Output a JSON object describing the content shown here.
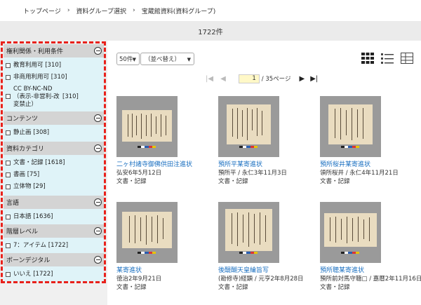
{
  "breadcrumb": {
    "items": [
      "トップページ",
      "資料グループ選択",
      "宝蔵館資料(資料グループ)"
    ]
  },
  "result_count": "1722件",
  "facets": [
    {
      "title": "権利関係・利用条件",
      "items": [
        {
          "label": "教育利用可",
          "count": "[310]"
        },
        {
          "label": "非商用利用可",
          "count": "[310]"
        },
        {
          "label": "CC BY-NC-ND（表示-非営利-改変禁止）",
          "count": "[310]"
        }
      ]
    },
    {
      "title": "コンテンツ",
      "items": [
        {
          "label": "静止画",
          "count": "[308]"
        }
      ]
    },
    {
      "title": "資料カテゴリ",
      "items": [
        {
          "label": "文書・記録",
          "count": "[1618]"
        },
        {
          "label": "書画",
          "count": "[75]"
        },
        {
          "label": "立体物",
          "count": "[29]"
        }
      ]
    },
    {
      "title": "言語",
      "items": [
        {
          "label": "日本語",
          "count": "[1636]"
        }
      ]
    },
    {
      "title": "階層レベル",
      "items": [
        {
          "label": "7：アイテム",
          "count": "[1722]"
        }
      ]
    },
    {
      "title": "ボーンデジタル",
      "items": [
        {
          "label": "いいえ",
          "count": "[1722]"
        }
      ]
    }
  ],
  "controls": {
    "per_page": "50件",
    "sort": "（並べ替え）"
  },
  "pager": {
    "current": "1",
    "total": "/ 35ページ"
  },
  "icons": {
    "first": "first-page-icon",
    "prev": "prev-page-icon",
    "next": "next-page-icon",
    "last": "last-page-icon",
    "grid": "grid-view-icon",
    "list": "list-view-icon",
    "table": "table-view-icon",
    "minus": "collapse-icon"
  },
  "colors": {
    "link": "#1a6fc0",
    "highlight_border": "#e8211b",
    "facet_bg": "#dff3f8",
    "page_input_bg": "#fff8c7"
  },
  "results": [
    {
      "title": "二ヶ村諸寺御佛供田注進状",
      "meta1": "弘安6年5月12日",
      "meta2": "文書・記録"
    },
    {
      "title": "預所平某寄進状",
      "meta1": "預所平 / 永仁3年11月3日",
      "meta2": "文書・記録"
    },
    {
      "title": "預所桜井某寄進状",
      "meta1": "領所桜井 / 永仁4年11月21日",
      "meta2": "文書・記録"
    },
    {
      "title": "某寄進状",
      "meta1": "徳治2年9月21日",
      "meta2": "文書・記録"
    },
    {
      "title": "後醍醐天皇綸旨写",
      "meta1": "(勘修寺)経顕 / 元亨2年8月28日",
      "meta2": "文書・記録"
    },
    {
      "title": "預所聴某寄進状",
      "meta1": "預所前対馬守聴□ / 嘉暦2年11月16日",
      "meta2": "文書・記録"
    }
  ]
}
